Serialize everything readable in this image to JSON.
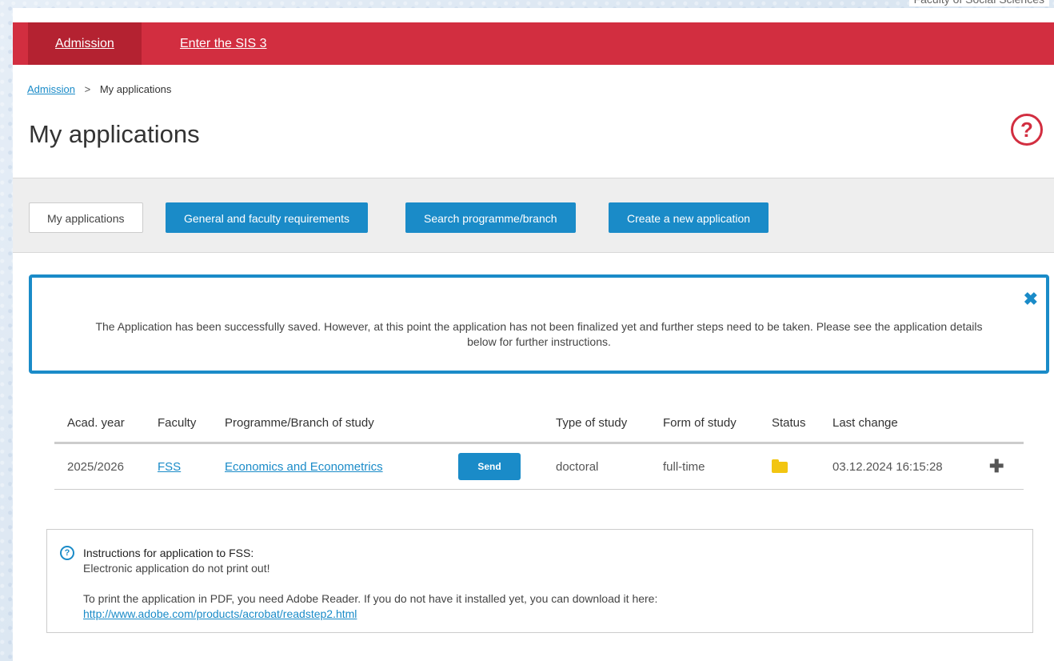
{
  "faculty_label": "Faculty of Social Sciences",
  "topnav": {
    "admission": "Admission",
    "sis": "Enter the SIS 3"
  },
  "breadcrumb": {
    "root": "Admission",
    "separator": ">",
    "current": "My applications"
  },
  "page_title": "My applications",
  "help_icon_glyph": "?",
  "toolbar": {
    "my_applications": "My applications",
    "requirements": "General and faculty requirements",
    "search": "Search programme/branch",
    "create": "Create a new application"
  },
  "alert": {
    "text": "The Application has been successfully saved. However, at this point the application has not been finalized yet and further steps need to be taken. Please see the application details below for further instructions.",
    "close_glyph": "✖"
  },
  "table": {
    "headers": {
      "year": "Acad. year",
      "faculty": "Faculty",
      "programme": "Programme/Branch of study",
      "type": "Type of study",
      "form": "Form of study",
      "status": "Status",
      "last_change": "Last change"
    },
    "rows": [
      {
        "year": "2025/2026",
        "faculty": "FSS",
        "programme": "Economics and Econometrics",
        "action": "Send",
        "type": "doctoral",
        "form": "full-time",
        "status_icon": "folder-icon",
        "last_change": "03.12.2024 16:15:28",
        "expand_glyph": "✚"
      }
    ]
  },
  "instructions": {
    "title": "Instructions for application to FSS:",
    "line1": "Electronic application do not print out!",
    "line2": "To print the application in PDF, you need Adobe Reader. If you do not have it installed yet, you can download it here:",
    "link": "http://www.adobe.com/products/acrobat/readstep2.html"
  },
  "colors": {
    "brand_red": "#d22e40",
    "accent_blue": "#1a8bc8",
    "folder_yellow": "#f2c511"
  }
}
